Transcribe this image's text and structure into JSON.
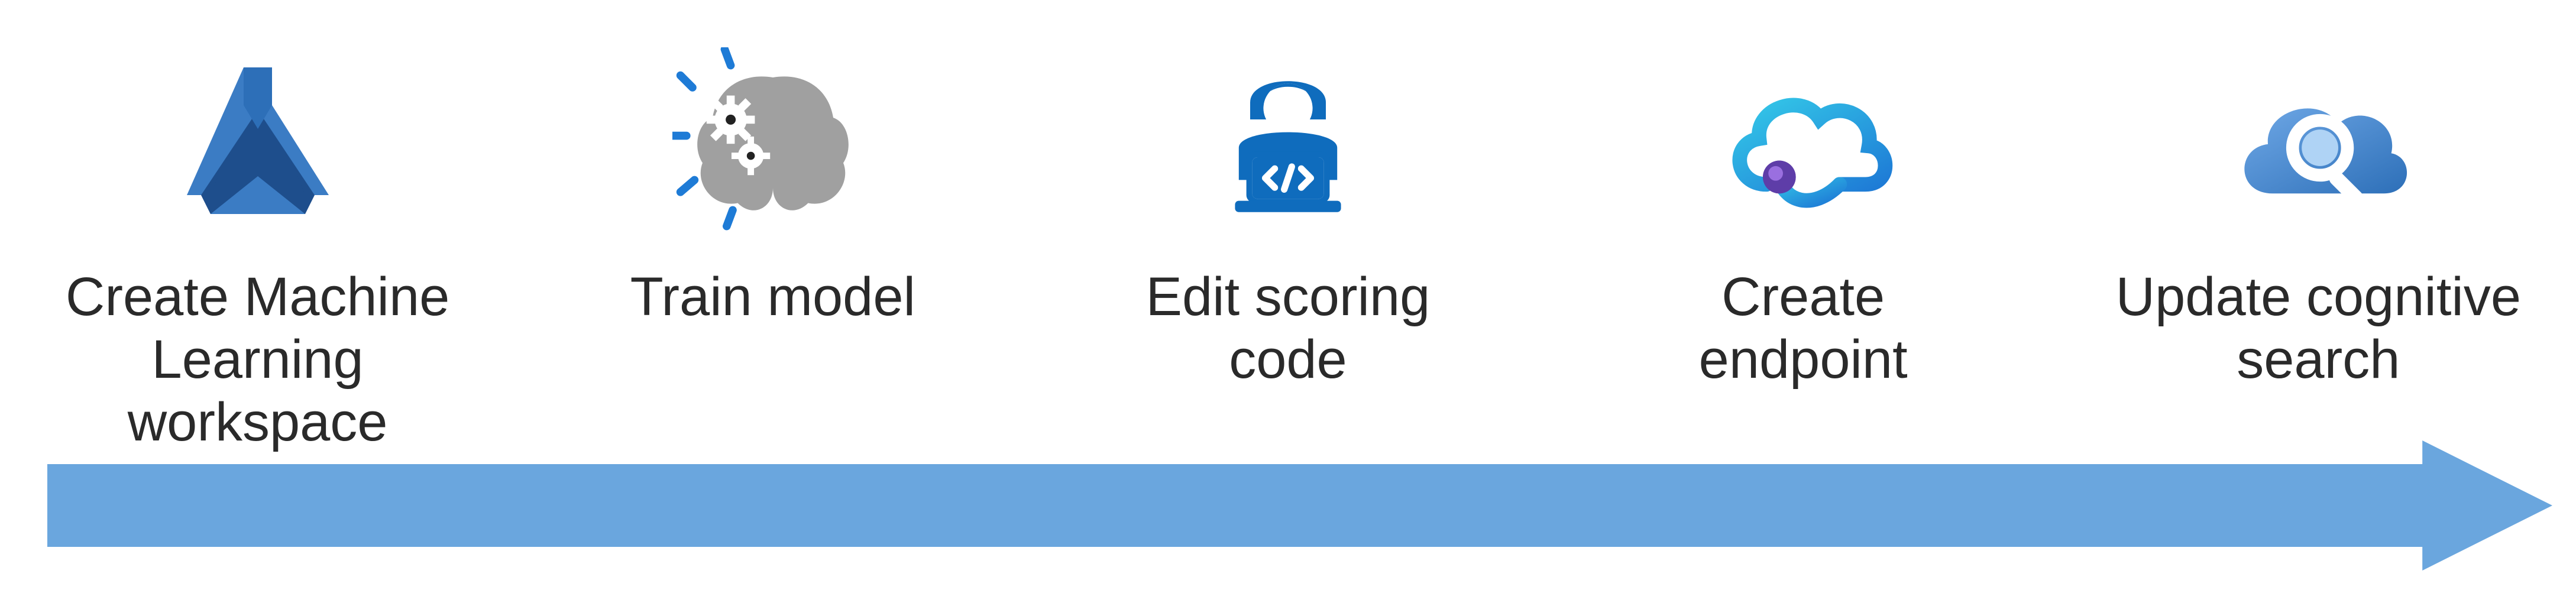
{
  "diagram": {
    "arrow_color": "#6AA6DE",
    "steps": [
      {
        "id": "create-ml-workspace",
        "label": "Create Machine\nLearning workspace",
        "icon": "ml-flask"
      },
      {
        "id": "train-model",
        "label": "Train model",
        "icon": "brain-gears"
      },
      {
        "id": "edit-scoring-code",
        "label": "Edit scoring\ncode",
        "icon": "dev-laptop"
      },
      {
        "id": "create-endpoint",
        "label": "Create\nendpoint",
        "icon": "cloud-endpoint"
      },
      {
        "id": "update-cognitive-search",
        "label": "Update cognitive\nsearch",
        "icon": "cloud-search"
      }
    ]
  }
}
